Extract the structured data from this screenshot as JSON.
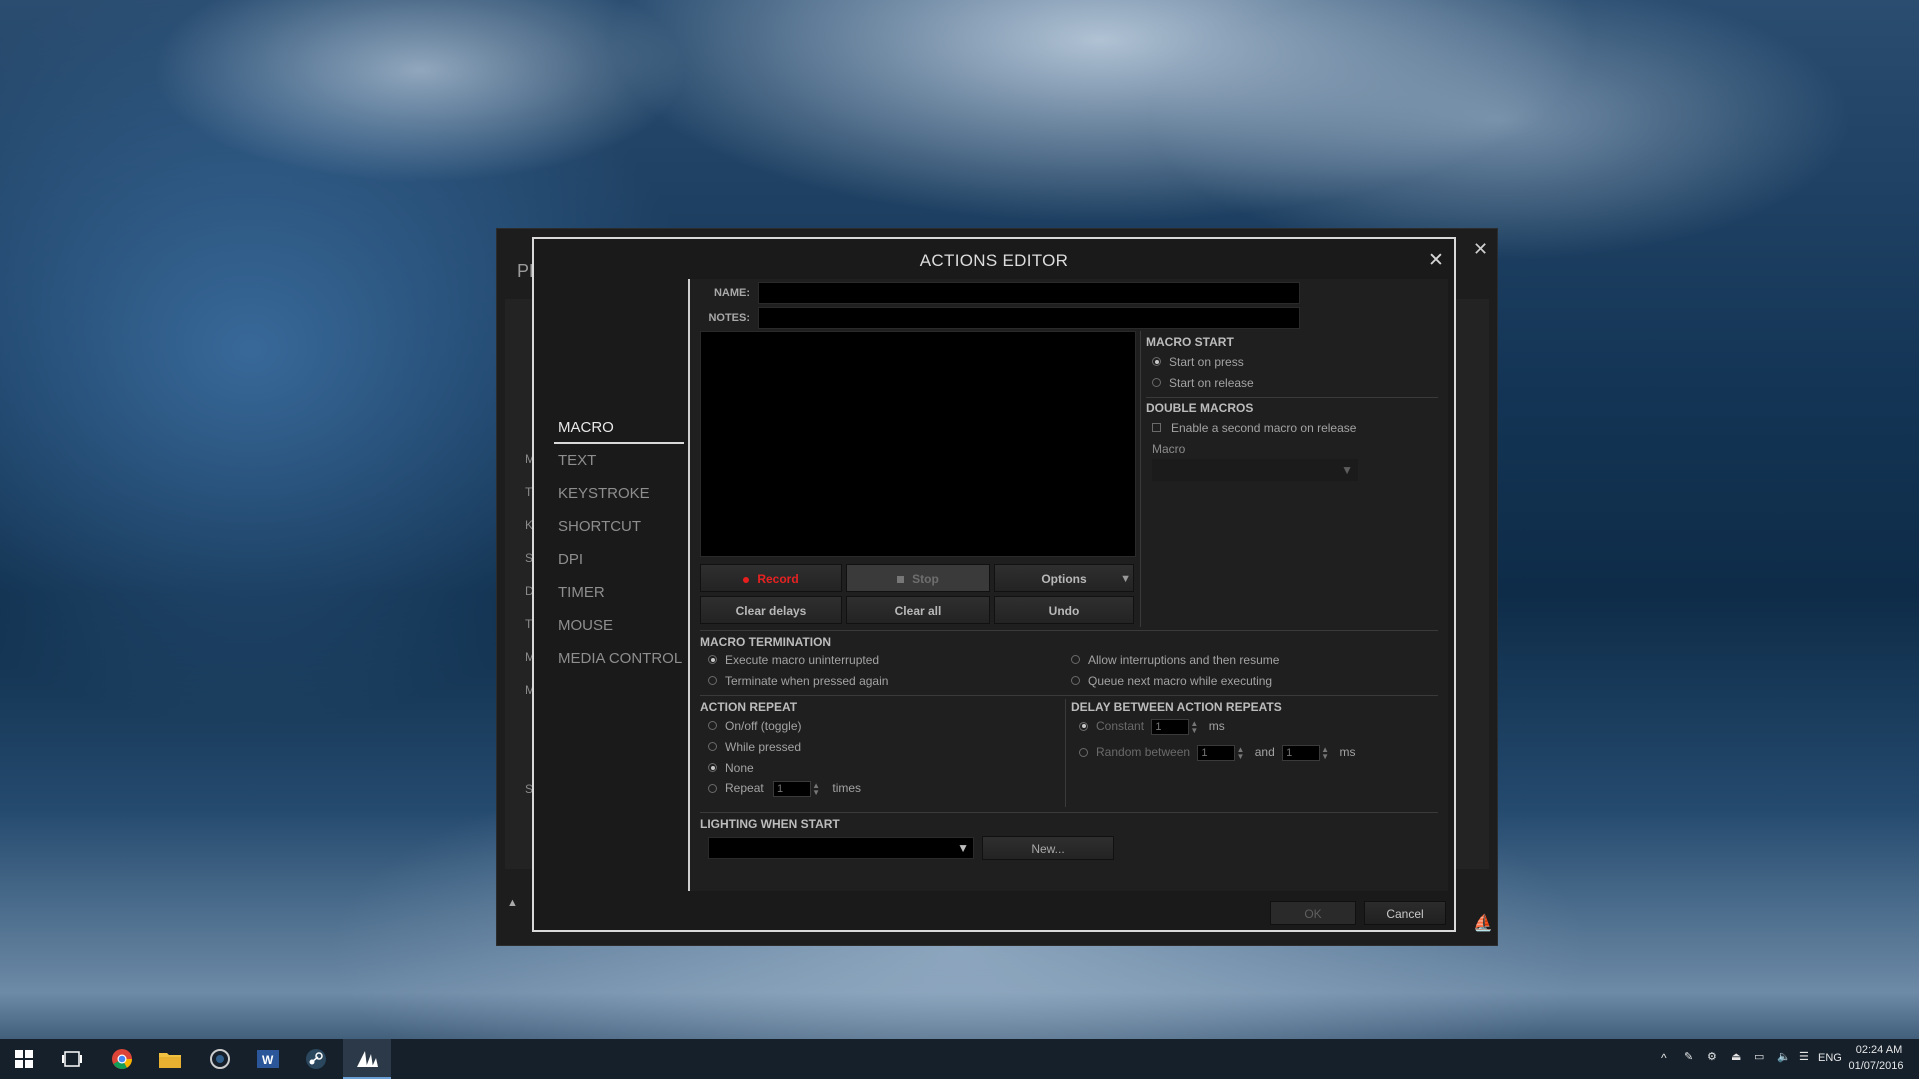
{
  "background_window": {
    "title_fragment": "PF",
    "side_letters": [
      "M",
      "T",
      "K",
      "S",
      "D",
      "T",
      "M",
      "M",
      "S"
    ]
  },
  "dialog": {
    "title": "ACTIONS EDITOR",
    "nav": [
      "MACRO",
      "TEXT",
      "KEYSTROKE",
      "SHORTCUT",
      "DPI",
      "TIMER",
      "MOUSE",
      "MEDIA CONTROL"
    ],
    "active_nav": "MACRO",
    "name_label": "NAME:",
    "notes_label": "NOTES:",
    "name_value": "",
    "notes_value": "",
    "buttons": {
      "record": "Record",
      "stop": "Stop",
      "options": "Options",
      "clear_delays": "Clear delays",
      "clear_all": "Clear all",
      "undo": "Undo"
    },
    "macro_start": {
      "title": "MACRO START",
      "options": [
        "Start on press",
        "Start on release"
      ],
      "selected": 0
    },
    "double_macros": {
      "title": "DOUBLE MACROS",
      "checkbox": "Enable a second macro on release",
      "macro_label": "Macro"
    },
    "macro_termination": {
      "title": "MACRO TERMINATION",
      "options": [
        "Execute macro uninterrupted",
        "Terminate when pressed again",
        "Allow interruptions and then resume",
        "Queue next macro while executing"
      ],
      "selected": 0
    },
    "action_repeat": {
      "title": "ACTION REPEAT",
      "options": [
        "On/off (toggle)",
        "While pressed",
        "None",
        "Repeat"
      ],
      "selected": 2,
      "repeat_value": "1",
      "times_label": "times"
    },
    "delay_between": {
      "title": "DELAY BETWEEN ACTION REPEATS",
      "constant_label": "Constant",
      "constant_value": "1",
      "ms": "ms",
      "random_label": "Random between",
      "random_from": "1",
      "and_label": "and",
      "random_to": "1"
    },
    "lighting": {
      "title": "LIGHTING WHEN START",
      "new_button": "New..."
    },
    "ok": "OK",
    "cancel": "Cancel"
  },
  "taskbar": {
    "language": "ENG",
    "time": "02:24 AM",
    "date": "01/07/2016"
  },
  "colors": {
    "accent_record": "#e81e1e",
    "taskbar": "#15202b",
    "dialog_bg": "#1a1a1a"
  }
}
